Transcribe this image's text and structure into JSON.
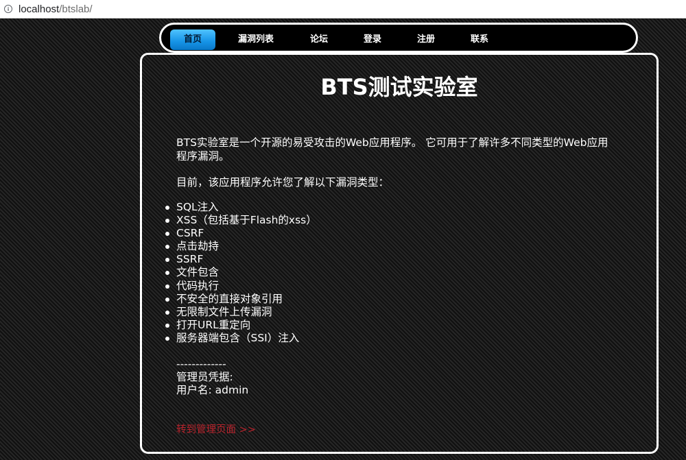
{
  "browser": {
    "url_host": "localhost",
    "url_path": "/btslab/"
  },
  "nav": {
    "items": [
      {
        "label": "首页",
        "active": true
      },
      {
        "label": "漏洞列表",
        "active": false
      },
      {
        "label": "论坛",
        "active": false
      },
      {
        "label": "登录",
        "active": false
      },
      {
        "label": "注册",
        "active": false
      },
      {
        "label": "联系",
        "active": false
      }
    ]
  },
  "main": {
    "title": "BTS测试实验室",
    "intro": "BTS实验室是一个开源的易受攻击的Web应用程序。 它可用于了解许多不同类型的Web应用程序漏洞。",
    "currently": "目前，该应用程序允许您了解以下漏洞类型：",
    "vulnerabilities": [
      "SQL注入",
      "XSS（包括基于Flash的xss）",
      "CSRF",
      "点击劫持",
      "SSRF",
      "文件包含",
      "代码执行",
      "不安全的直接对象引用",
      "无限制文件上传漏洞",
      "打开URL重定向",
      "服务器端包含（SSI）注入"
    ],
    "separator": "-------------",
    "credentials_heading": "管理员凭据:",
    "username_line": "用户名: admin",
    "admin_link": "转到管理页面 >>"
  },
  "colors": {
    "accent": "#1593e6",
    "link": "#b8232c"
  }
}
